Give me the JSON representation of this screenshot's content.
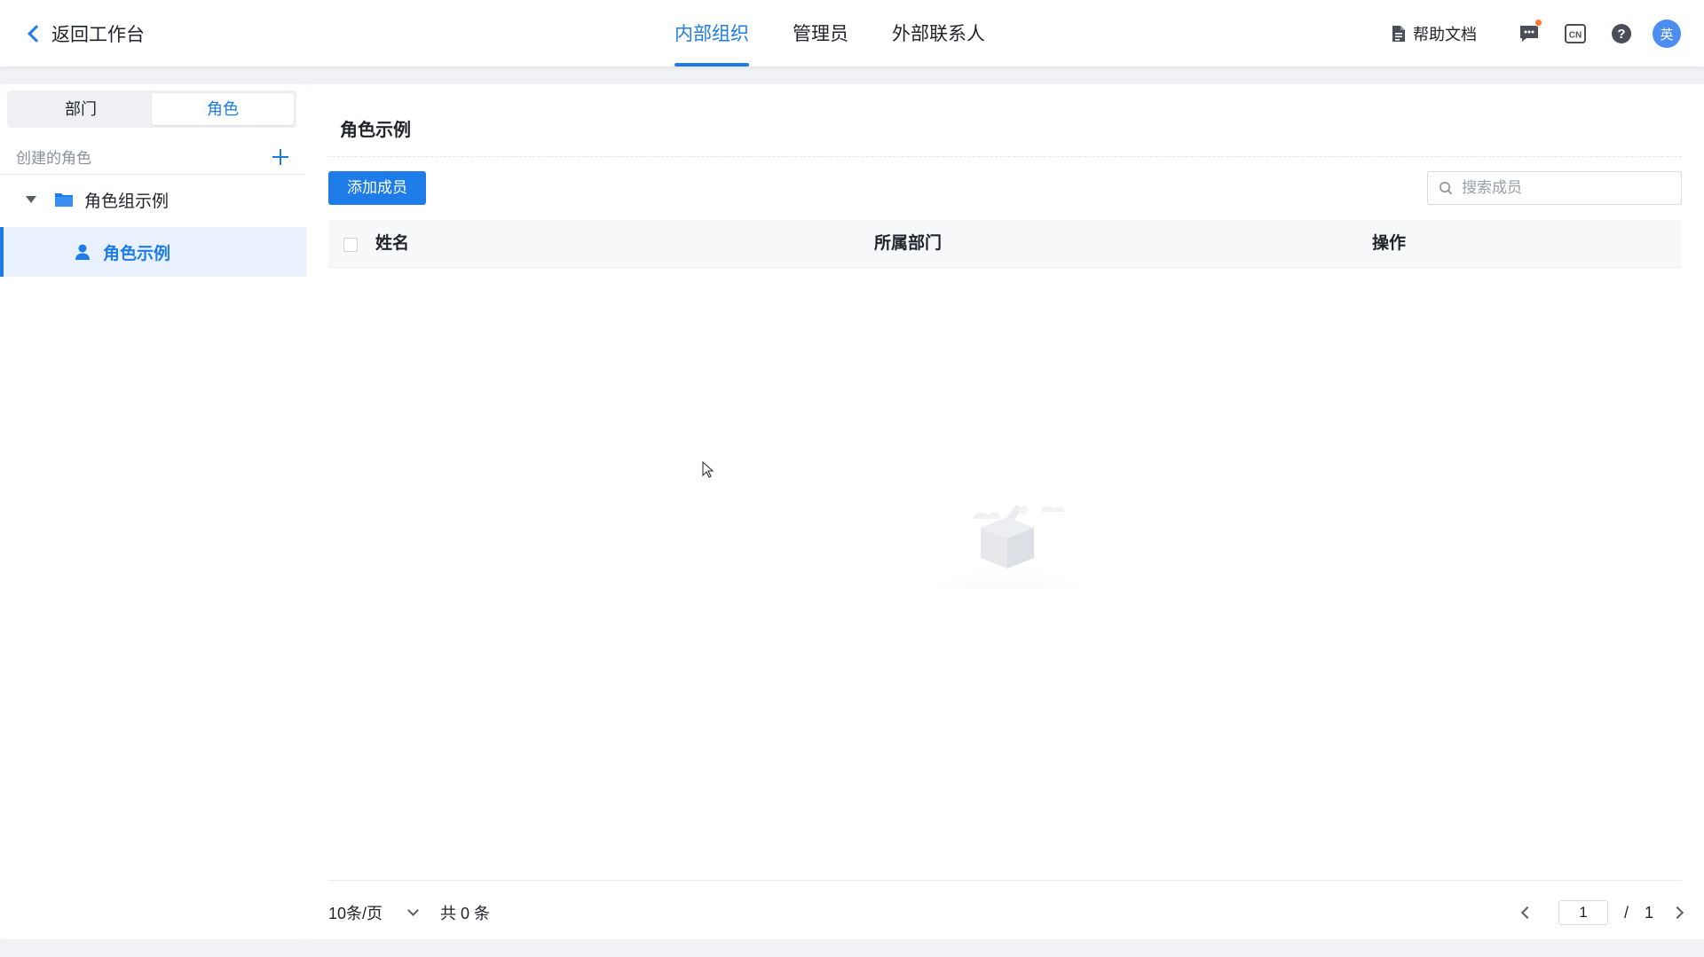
{
  "header": {
    "back_label": "返回工作台",
    "tabs": [
      {
        "label": "内部组织",
        "active": true
      },
      {
        "label": "管理员",
        "active": false
      },
      {
        "label": "外部联系人",
        "active": false
      }
    ],
    "help_doc_label": "帮助文档",
    "lang_icon_text": "CN",
    "avatar_text": "英"
  },
  "sidebar": {
    "segment": {
      "department": "部门",
      "role": "角色",
      "active": "role"
    },
    "created_roles_label": "创建的角色",
    "group_label": "角色组示例",
    "role_label": "角色示例"
  },
  "main": {
    "title": "角色示例",
    "add_member_label": "添加成员",
    "search_placeholder": "搜索成员",
    "columns": {
      "name": "姓名",
      "department": "所属部门",
      "actions": "操作"
    },
    "rows": []
  },
  "pagination": {
    "page_size_label": "10条/页",
    "total_label": "共 0 条",
    "current_page": "1",
    "separator": "/",
    "total_pages": "1"
  },
  "colors": {
    "accent": "#1e7ce8",
    "badge": "#ff7a2f",
    "avatar_bg": "#4b8ef0"
  }
}
